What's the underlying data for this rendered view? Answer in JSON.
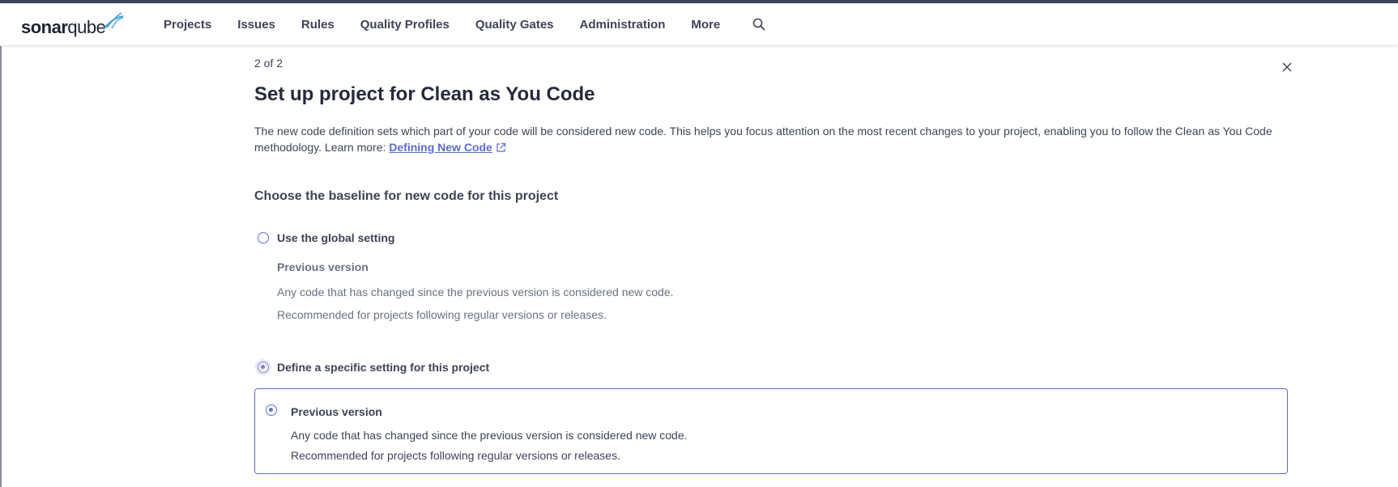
{
  "navbar": {
    "logo": {
      "part1": "sonar",
      "part2": "qube"
    },
    "items": [
      "Projects",
      "Issues",
      "Rules",
      "Quality Profiles",
      "Quality Gates",
      "Administration",
      "More"
    ],
    "search_icon": "search-icon"
  },
  "modal": {
    "step": "2 of 2",
    "title": "Set up project for Clean as You Code",
    "description_text": "The new code definition sets which part of your code will be considered new code. This helps you focus attention on the most recent changes to your project, enabling you to follow the Clean as You Code methodology. Learn more: ",
    "description_link": "Defining New Code",
    "subtitle": "Choose the baseline for new code for this project",
    "global_option": {
      "label": "Use the global setting",
      "checked": false,
      "setting_title": "Previous version",
      "setting_desc1": "Any code that has changed since the previous version is considered new code.",
      "setting_desc2": "Recommended for projects following regular versions or releases."
    },
    "specific_option": {
      "label": "Define a specific setting for this project",
      "checked": true
    },
    "specific_card": {
      "label": "Previous version",
      "checked": true,
      "desc1": "Any code that has changed since the previous version is considered new code.",
      "desc2": "Recommended for projects following regular versions or releases."
    }
  },
  "colors": {
    "accent": "#5d6cd0",
    "text": "#3e4357",
    "muted": "#6b7085"
  }
}
